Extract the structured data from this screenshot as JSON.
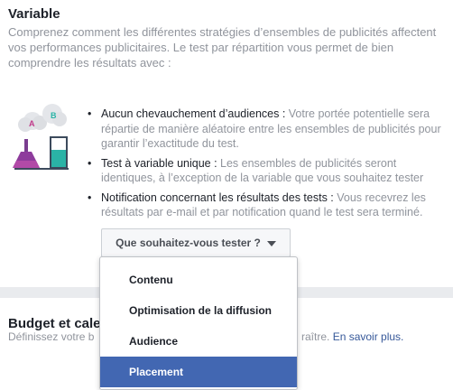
{
  "variable_section": {
    "title": "Variable",
    "description": "Comprenez comment les différentes stratégies d’ensembles de publicités affectent vos performances publicitaires. Le test par répartition vous permet de bien comprendre les résultats avec :",
    "illustration": {
      "icon": "ab-test-flasks-icon",
      "label_a": "A",
      "label_b": "B"
    },
    "bullets": [
      {
        "title": "Aucun chevauchement d’audiences : ",
        "text": "Votre portée potentielle sera répartie de manière aléatoire entre les ensembles de publicités pour garantir l’exactitude du test."
      },
      {
        "title": "Test à variable unique : ",
        "text": "Les ensembles de publicités seront identiques, à l’exception de la variable que vous souhaitez tester"
      },
      {
        "title": "Notification concernant les résultats des tests : ",
        "text": "Vous recevrez les résultats par e-mail et par notification quand le test sera terminé."
      }
    ],
    "test_button_label": "Que souhaitez-vous tester ?"
  },
  "dropdown": {
    "items": [
      "Contenu",
      "Optimisation de la diffusion",
      "Audience",
      "Placement"
    ],
    "selected": "Placement"
  },
  "budget_section": {
    "title": "Budget et caler",
    "description_start": "Définissez votre b",
    "description_end": "raître. ",
    "link": "En savoir plus."
  },
  "colors": {
    "selected_bg": "#4267b2",
    "link": "#365899",
    "muted_text": "#90949c"
  }
}
